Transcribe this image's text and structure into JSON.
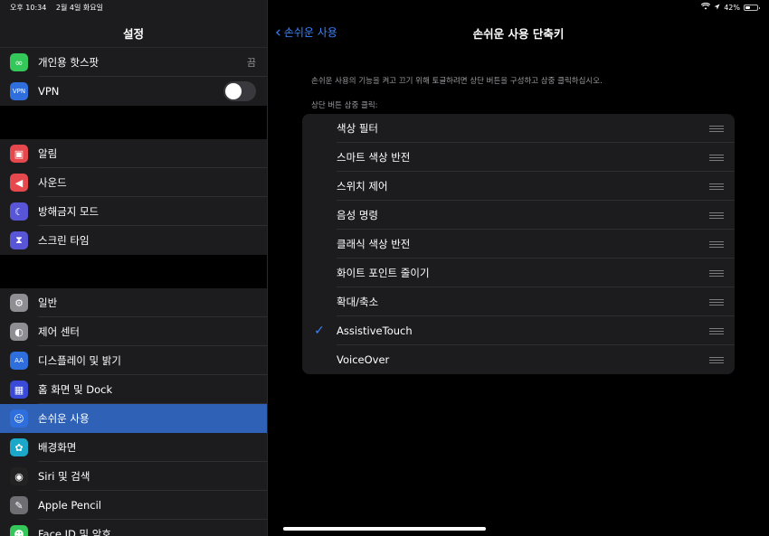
{
  "status_bar": {
    "time": "오후 10:34",
    "date": "2월 4일 화요일",
    "battery_percent": "42%",
    "battery_level": 0.42
  },
  "sidebar": {
    "title": "설정",
    "groups": [
      [
        {
          "label": "개인용 핫스팟",
          "icon": "hotspot-icon",
          "color": "#34c759",
          "value": "끔"
        },
        {
          "label": "VPN",
          "icon": "vpn-icon",
          "color": "#2f6fdd",
          "toggle": false
        }
      ],
      [
        {
          "label": "알림",
          "icon": "notifications-icon",
          "color": "#e5484d"
        },
        {
          "label": "사운드",
          "icon": "sound-icon",
          "color": "#e5484d"
        },
        {
          "label": "방해금지 모드",
          "icon": "moon-icon",
          "color": "#5856d6"
        },
        {
          "label": "스크린 타임",
          "icon": "hourglass-icon",
          "color": "#5856d6"
        }
      ],
      [
        {
          "label": "일반",
          "icon": "gear-icon",
          "color": "#8e8e93"
        },
        {
          "label": "제어 센터",
          "icon": "control-center-icon",
          "color": "#8e8e93"
        },
        {
          "label": "디스플레이 및 밝기",
          "icon": "display-icon",
          "color": "#2f6fdd"
        },
        {
          "label": "홈 화면 및 Dock",
          "icon": "home-screen-icon",
          "color": "#3a4ad6"
        },
        {
          "label": "손쉬운 사용",
          "icon": "accessibility-icon",
          "color": "#2f6fdd",
          "selected": true
        },
        {
          "label": "배경화면",
          "icon": "wallpaper-icon",
          "color": "#1aa7c8"
        },
        {
          "label": "Siri 및 검색",
          "icon": "siri-icon",
          "color": "#222"
        },
        {
          "label": "Apple Pencil",
          "icon": "pencil-icon",
          "color": "#6e6e73"
        },
        {
          "label": "Face ID 및 암호",
          "icon": "face-id-icon",
          "color": "#34c759"
        }
      ]
    ]
  },
  "detail": {
    "back_label": "손쉬운 사용",
    "title": "손쉬운 사용 단축키",
    "description": "손쉬운 사용의 기능을 켜고 끄기 위해 토글하려면 상단 버튼을 구성하고 삼중 클릭하십시오.",
    "section_label": "상단 버튼 삼중 클릭:",
    "items": [
      {
        "label": "색상 필터",
        "checked": false
      },
      {
        "label": "스마트 색상 반전",
        "checked": false
      },
      {
        "label": "스위치 제어",
        "checked": false
      },
      {
        "label": "음성 명령",
        "checked": false
      },
      {
        "label": "클래식 색상 반전",
        "checked": false
      },
      {
        "label": "화이트 포인트 줄이기",
        "checked": false
      },
      {
        "label": "확대/축소",
        "checked": false
      },
      {
        "label": "AssistiveTouch",
        "checked": true
      },
      {
        "label": "VoiceOver",
        "checked": false
      }
    ]
  },
  "colors": {
    "accent": "#3b82f6",
    "selected_row": "#2f62b6"
  }
}
